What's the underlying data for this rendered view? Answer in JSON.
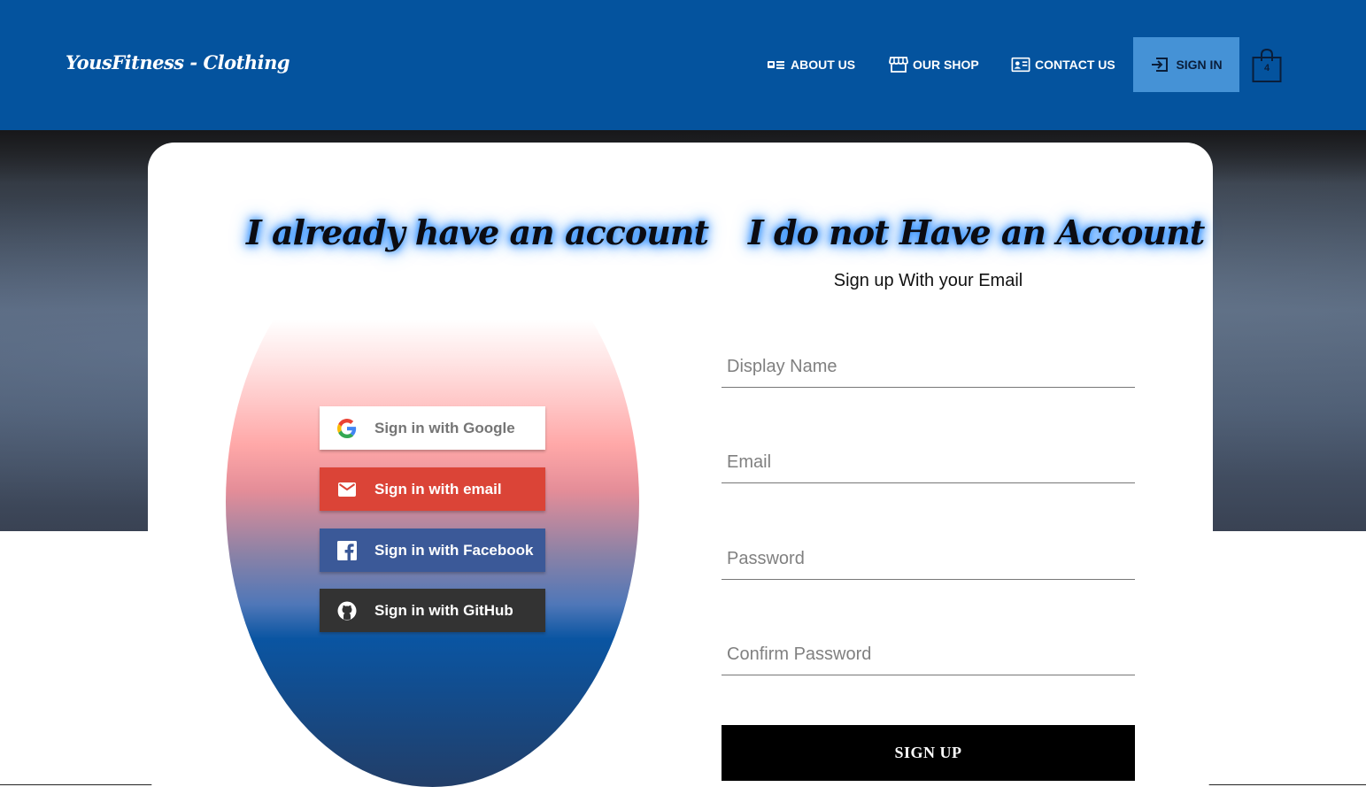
{
  "header": {
    "logo": "YousFitness - Clothing",
    "nav": {
      "about": "ABOUT US",
      "shop": "OUR SHOP",
      "contact": "CONTACT US",
      "signin": "SIGN IN"
    },
    "cart_count": "4"
  },
  "signin": {
    "heading": "I already have an account",
    "google": "Sign in with Google",
    "email": "Sign in with email",
    "facebook": "Sign in with Facebook",
    "github": "Sign in with GitHub"
  },
  "signup": {
    "heading": "I do not Have an Account",
    "subheading": "Sign up With your Email",
    "display_name_placeholder": "Display Name",
    "email_placeholder": "Email",
    "password_placeholder": "Password",
    "confirm_password_placeholder": "Confirm Password",
    "submit": "SIGN UP"
  },
  "icons": {
    "about": "id-card-icon",
    "shop": "storefront-icon",
    "contact": "contact-card-icon",
    "signin": "login-icon",
    "cart": "shopping-bag-icon",
    "google": "google-icon",
    "email": "mail-icon",
    "facebook": "facebook-icon",
    "github": "github-icon"
  },
  "colors": {
    "header_bg": "#04539e",
    "signin_nav_bg": "#4592d6",
    "google_btn": "#ffffff",
    "email_btn": "#db4437",
    "facebook_btn": "#3b5998",
    "github_btn": "#333333",
    "signup_btn": "#000000",
    "heading_glow": "#2a8cff"
  }
}
